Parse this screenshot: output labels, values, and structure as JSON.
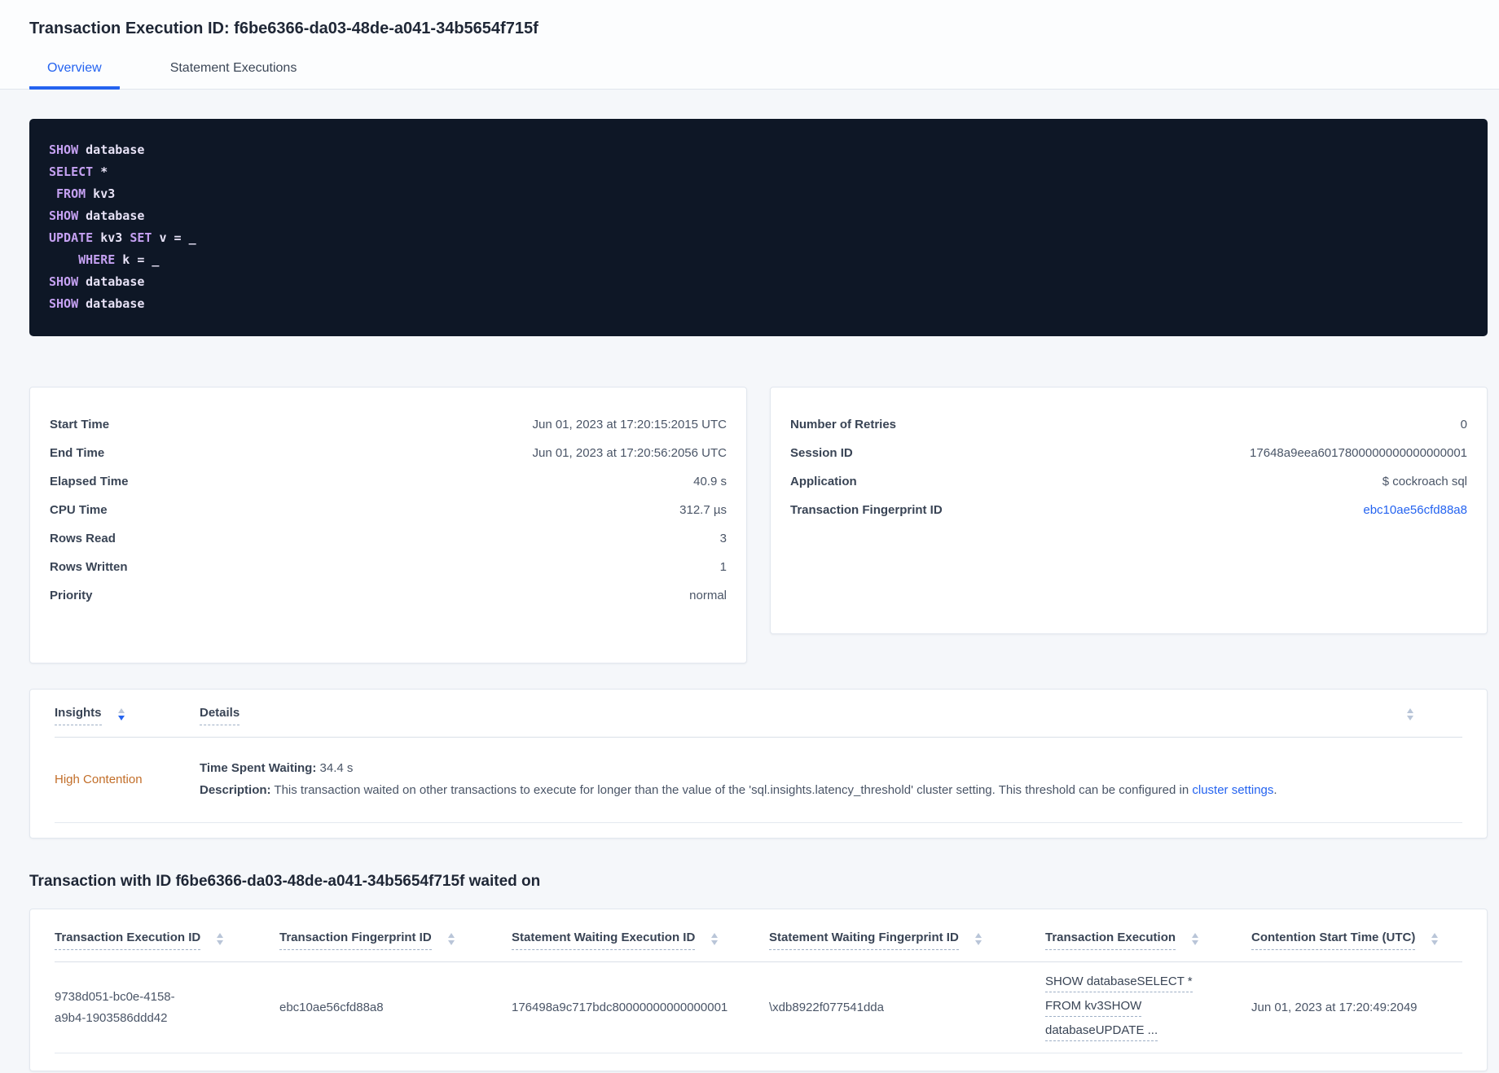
{
  "colors": {
    "accent_blue": "#2463f0",
    "high_contention_orange": "#c26e29",
    "code_background": "#0e1726",
    "code_keyword_purple": "#c5a1f2",
    "code_plain_text": "#e7e2f6",
    "active_sort_arrow_blue": "#2463f0"
  },
  "header": {
    "title": "Transaction Execution ID: f6be6366-da03-48de-a041-34b5654f715f",
    "tabs": [
      {
        "label": "Overview"
      },
      {
        "label": "Statement Executions"
      }
    ]
  },
  "sql_statements": {
    "lines": [
      [
        {
          "t": "kw",
          "s": "SHOW"
        },
        {
          "t": "pl",
          "s": " database"
        }
      ],
      [
        {
          "t": "kw",
          "s": "SELECT"
        },
        {
          "t": "pl",
          "s": " *"
        }
      ],
      [
        {
          "t": "pl",
          "s": " "
        },
        {
          "t": "kw",
          "s": "FROM"
        },
        {
          "t": "pl",
          "s": " kv3"
        }
      ],
      [
        {
          "t": "kw",
          "s": "SHOW"
        },
        {
          "t": "pl",
          "s": " database"
        }
      ],
      [
        {
          "t": "kw",
          "s": "UPDATE"
        },
        {
          "t": "pl",
          "s": " kv3 "
        },
        {
          "t": "kw",
          "s": "SET"
        },
        {
          "t": "pl",
          "s": " v = _"
        }
      ],
      [
        {
          "t": "pl",
          "s": "    "
        },
        {
          "t": "kw",
          "s": "WHERE"
        },
        {
          "t": "pl",
          "s": " k = _"
        }
      ],
      [
        {
          "t": "kw",
          "s": "SHOW"
        },
        {
          "t": "pl",
          "s": " database"
        }
      ],
      [
        {
          "t": "kw",
          "s": "SHOW"
        },
        {
          "t": "pl",
          "s": " database"
        }
      ]
    ]
  },
  "details_left": {
    "rows": [
      {
        "label": "Start Time",
        "value": "Jun 01, 2023 at 17:20:15:2015 UTC"
      },
      {
        "label": "End Time",
        "value": "Jun 01, 2023 at 17:20:56:2056 UTC"
      },
      {
        "label": "Elapsed Time",
        "value": "40.9 s"
      },
      {
        "label": "CPU Time",
        "value": "312.7 µs"
      },
      {
        "label": "Rows Read",
        "value": "3"
      },
      {
        "label": "Rows Written",
        "value": "1"
      },
      {
        "label": "Priority",
        "value": "normal"
      }
    ]
  },
  "details_right": {
    "rows": [
      {
        "label": "Number of Retries",
        "value": "0"
      },
      {
        "label": "Session ID",
        "value": "17648a9eea6017800000000000000001"
      },
      {
        "label": "Application",
        "value": "$ cockroach sql"
      },
      {
        "label": "Transaction Fingerprint ID",
        "value": "ebc10ae56cfd88a8"
      }
    ]
  },
  "insights": {
    "col_insights": "Insights",
    "col_details": "Details",
    "row": {
      "insight": "High Contention",
      "time_spent_label": "Time Spent Waiting:",
      "time_spent_value": "34.4 s",
      "description_label": "Description:",
      "description_text": "This transaction waited on other transactions to execute for longer than the value of the 'sql.insights.latency_threshold' cluster setting. This threshold can be configured in ",
      "description_link": "cluster settings",
      "description_period": "."
    }
  },
  "waited_on": {
    "heading": "Transaction with ID f6be6366-da03-48de-a041-34b5654f715f waited on",
    "columns": [
      "Transaction Execution ID",
      "Transaction Fingerprint ID",
      "Statement Waiting Execution ID",
      "Statement Waiting Fingerprint ID",
      "Transaction Execution",
      "Contention Start Time (UTC)"
    ],
    "row": {
      "transaction_execution_id": "9738d051-bc0e-4158-a9b4-1903586ddd42",
      "transaction_fingerprint_id": "ebc10ae56cfd88a8",
      "statement_waiting_execution_id": "176498a9c717bdc80000000000000001",
      "statement_waiting_fingerprint_id": "\\xdb8922f077541dda",
      "transaction_execution_lines": [
        "SHOW databaseSELECT *",
        "FROM kv3SHOW",
        "databaseUPDATE ..."
      ],
      "contention_start_time": "Jun 01, 2023 at 17:20:49:2049"
    }
  }
}
